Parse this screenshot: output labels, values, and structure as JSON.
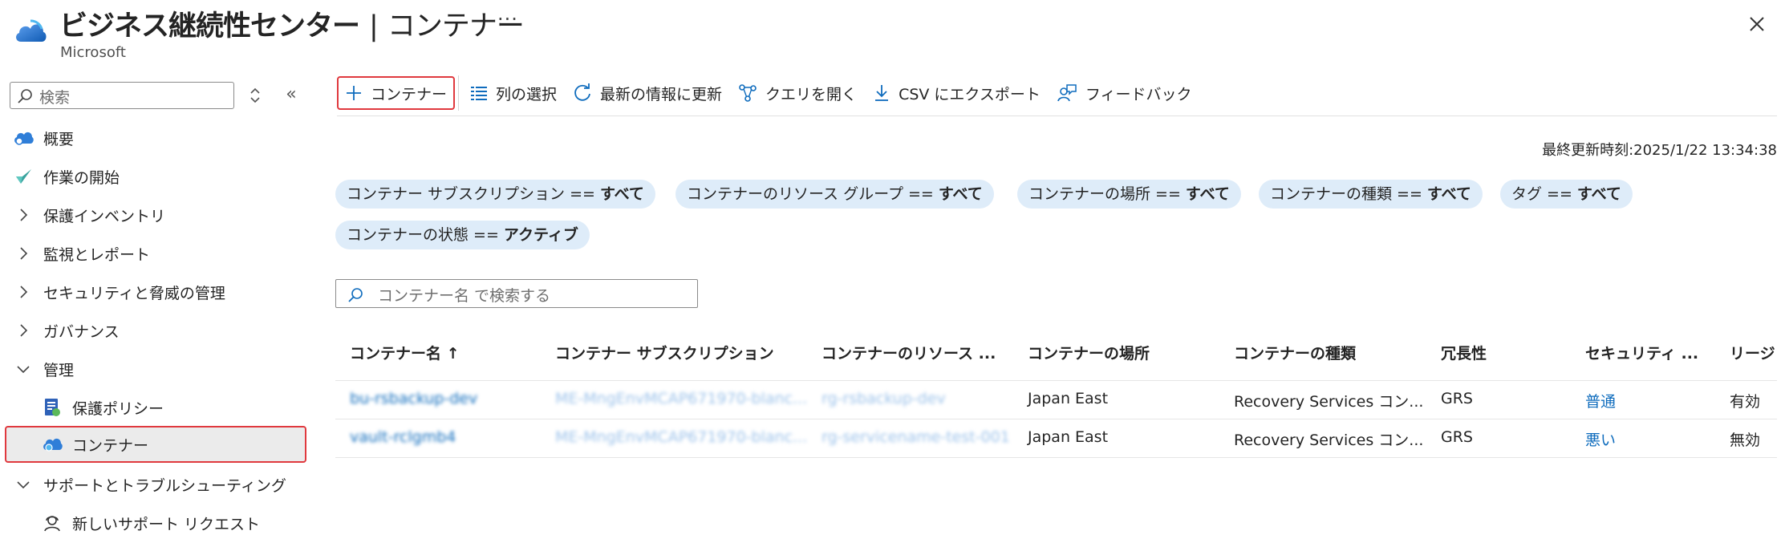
{
  "header": {
    "title": "ビジネス継続性センター",
    "separator": "|",
    "subtitle": "コンテナー",
    "org": "Microsoft",
    "more": "···"
  },
  "sidebar": {
    "search_placeholder": "検索",
    "collapse": "«",
    "items": [
      {
        "label": "概要",
        "icon": "overview-cloud-icon"
      },
      {
        "label": "作業の開始",
        "icon": "getting-started-icon"
      },
      {
        "label": "保護インベントリ",
        "icon": "chevron-right-icon"
      },
      {
        "label": "監視とレポート",
        "icon": "chevron-right-icon"
      },
      {
        "label": "セキュリティと脅威の管理",
        "icon": "chevron-right-icon"
      },
      {
        "label": "ガバナンス",
        "icon": "chevron-right-icon"
      },
      {
        "label": "管理",
        "icon": "chevron-down-icon"
      },
      {
        "label": "保護ポリシー",
        "icon": "policy-icon"
      },
      {
        "label": "コンテナー",
        "icon": "vault-cloud-icon"
      },
      {
        "label": "サポートとトラブルシューティング",
        "icon": "chevron-down-icon"
      },
      {
        "label": "新しいサポート リクエスト",
        "icon": "support-person-icon"
      }
    ]
  },
  "toolbar": {
    "add": "コンテナー",
    "columns": "列の選択",
    "refresh": "最新の情報に更新",
    "query": "クエリを開く",
    "export": "CSV にエクスポート",
    "feedback": "フィードバック"
  },
  "last_updated": "最終更新時刻:2025/1/22 13:34:38",
  "filters": [
    {
      "label": "コンテナー サブスクリプション == ",
      "value": "すべて"
    },
    {
      "label": "コンテナーのリソース グループ == ",
      "value": "すべて"
    },
    {
      "label": "コンテナーの場所 == ",
      "value": "すべて"
    },
    {
      "label": "コンテナーの種類 == ",
      "value": "すべて"
    },
    {
      "label": "タグ == ",
      "value": "すべて"
    },
    {
      "label": "コンテナーの状態 == ",
      "value": "アクティブ"
    }
  ],
  "grid_search_placeholder": "コンテナー名 で検索する",
  "table": {
    "columns": [
      "コンテナー名 ↑",
      "コンテナー サブスクリプション",
      "コンテナーのリソース ...",
      "コンテナーの場所",
      "コンテナーの種類",
      "冗長性",
      "セキュリティ ...",
      "リージ"
    ],
    "rows": [
      [
        "bu-rsbackup-dev",
        "ME-MngEnvMCAP671970-blanc...",
        "rg-rsbackup-dev",
        "Japan East",
        "Recovery Services コン...",
        "GRS",
        "普通",
        "有効"
      ],
      [
        "vault-rclgmb4",
        "ME-MngEnvMCAP671970-blanc...",
        "rg-servicename-test-001",
        "Japan East",
        "Recovery Services コン...",
        "GRS",
        "悪い",
        "無効"
      ]
    ]
  },
  "colors": {
    "accent": "#0f6cbd",
    "highlight_border": "#e0393e",
    "pill_bg": "#deecf9"
  }
}
